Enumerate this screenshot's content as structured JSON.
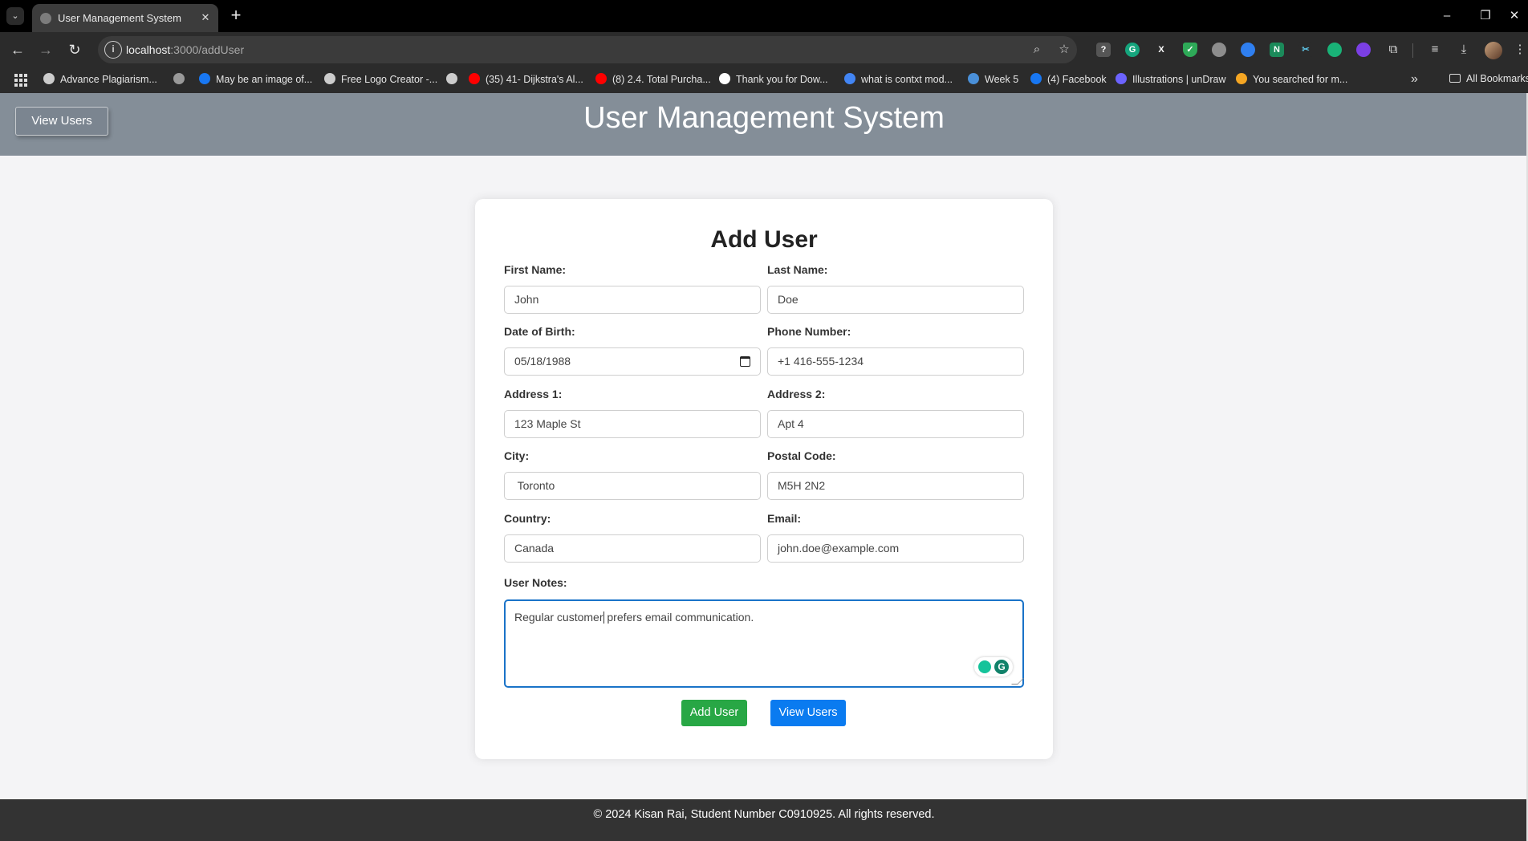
{
  "browser": {
    "tab_title": "User Management System",
    "tab_close": "✕",
    "new_tab": "+",
    "url_host": "localhost",
    "url_rest": ":3000/addUser",
    "window_controls": {
      "minimize": "–",
      "restore": "❐",
      "close": "✕"
    },
    "bookmarks": [
      {
        "label": "Advance Plagiarism...",
        "icon": "globe-icon",
        "color": "#cccccc"
      },
      {
        "label": "",
        "icon": "site-icon",
        "color": "#999999"
      },
      {
        "label": "May be an image of...",
        "icon": "facebook-icon",
        "color": "#1877f2"
      },
      {
        "label": "Free Logo Creator -...",
        "icon": "globe-icon",
        "color": "#cccccc"
      },
      {
        "label": "",
        "icon": "globe-icon",
        "color": "#cccccc"
      },
      {
        "label": "(35) 41- Dijkstra's Al...",
        "icon": "youtube-icon",
        "color": "#ff0000"
      },
      {
        "label": "(8) 2.4. Total Purcha...",
        "icon": "youtube-icon",
        "color": "#ff0000"
      },
      {
        "label": "Thank you for Dow...",
        "icon": "x-icon",
        "color": "#ffffff"
      },
      {
        "label": "what is contxt mod...",
        "icon": "google-icon",
        "color": "#4285f4"
      },
      {
        "label": "Week 5",
        "icon": "classroom-icon",
        "color": "#4a90d9"
      },
      {
        "label": "(4) Facebook",
        "icon": "facebook-icon",
        "color": "#1877f2"
      },
      {
        "label": "Illustrations | unDraw",
        "icon": "undraw-icon",
        "color": "#6c63ff"
      },
      {
        "label": "You searched for m...",
        "icon": "download-site-icon",
        "color": "#f5a623"
      }
    ],
    "all_bookmarks": "All Bookmarks",
    "more_bookmarks": "»"
  },
  "header": {
    "view_users_label": "View Users",
    "title": "User Management System"
  },
  "form": {
    "title": "Add User",
    "fields": {
      "first_name": {
        "label": "First Name:",
        "value": "John"
      },
      "last_name": {
        "label": "Last Name:",
        "value": "Doe"
      },
      "dob": {
        "label": "Date of Birth:",
        "value": "05/18/1988"
      },
      "phone": {
        "label": "Phone Number:",
        "value": "+1 416-555-1234"
      },
      "address1": {
        "label": "Address 1:",
        "value": "123 Maple St"
      },
      "address2": {
        "label": "Address 2:",
        "value": "Apt 4"
      },
      "city": {
        "label": "City:",
        "value": " Toronto"
      },
      "postal": {
        "label": "Postal Code:",
        "value": "M5H 2N2"
      },
      "country": {
        "label": "Country:",
        "value": "Canada"
      },
      "email": {
        "label": "Email:",
        "value": "john.doe@example.com"
      }
    },
    "notes": {
      "label": "User Notes:",
      "before_caret": "Regular customer",
      "after_caret": " prefers email communication."
    },
    "add_button": "Add User",
    "view_button": "View Users",
    "colors": {
      "add": "#28a745",
      "view": "#0a7bf0",
      "focus": "#1a73c8"
    }
  },
  "footer": {
    "text": "© 2024 Kisan Rai, Student Number C0910925. All rights reserved."
  }
}
